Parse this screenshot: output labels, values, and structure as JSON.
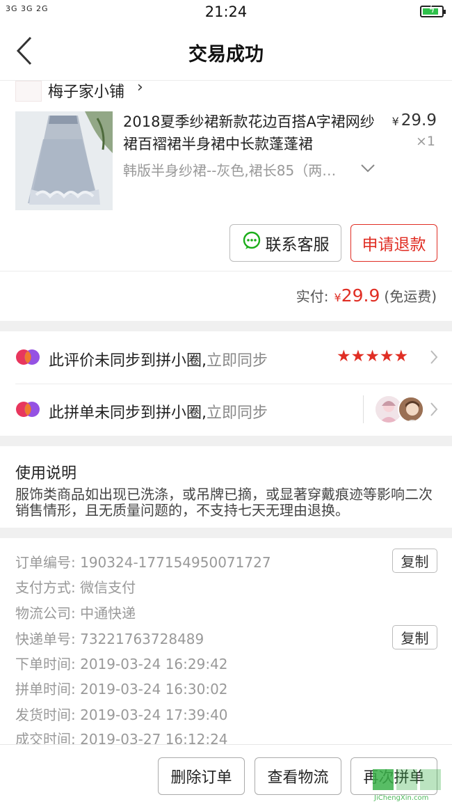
{
  "status_bar": {
    "signal": "3G 3G   2G",
    "time": "21:24",
    "battery_level": 0.8,
    "battery_icon": "battery-charging-icon"
  },
  "nav": {
    "title": "交易成功",
    "back_icon": "back-arrow-icon"
  },
  "shop": {
    "logo_text": "梅子家小铺",
    "name": "梅子家小铺",
    "arrow": "›"
  },
  "product": {
    "title": "2018夏季纱裙新款花边百搭A字裙网纱裙百褶裙半身裙中长款蓬蓬裙",
    "currency": "¥",
    "price": "29.9",
    "quantity": "×1",
    "spec": "韩版半身纱裙--灰色,裙长85（两…"
  },
  "actions": {
    "contact_service": "联系客服",
    "request_refund": "申请退款"
  },
  "payment": {
    "label": "实付:",
    "currency": "¥",
    "amount": "29.9",
    "shipping": "(免运费)"
  },
  "sync": [
    {
      "text": "此评价未同步到拼小圈,",
      "action": "立即同步",
      "rating": 5,
      "stars": "★★★★★"
    },
    {
      "text": "此拼单未同步到拼小圈,",
      "action": "立即同步"
    }
  ],
  "notice": {
    "title": "使用说明",
    "body": "服饰类商品如出现已洗涤，或吊牌已摘，或显著穿戴痕迹等影响二次销售情形，且无质量问题的，不支持七天无理由退换。"
  },
  "order_info": {
    "copy_label": "复制",
    "rows": [
      {
        "label": "订单编号:",
        "value": "190324-177154950071727"
      },
      {
        "label": "支付方式:",
        "value": "微信支付"
      },
      {
        "label": "物流公司:",
        "value": "中通快递"
      },
      {
        "label": "快递单号:",
        "value": "73221763728489"
      },
      {
        "label": "下单时间:",
        "value": "2019-03-24 16:29:42"
      },
      {
        "label": "拼单时间:",
        "value": "2019-03-24 16:30:02"
      },
      {
        "label": "发货时间:",
        "value": "2019-03-24 17:39:40"
      },
      {
        "label": "成交时间:",
        "value": "2019-03-27 16:12:24"
      }
    ]
  },
  "bottom": {
    "delete_order": "删除订单",
    "view_logistics": "查看物流",
    "group_again": "再次拼单"
  },
  "watermark": {
    "text": "JiChengXin.com"
  },
  "colors": {
    "accent": "#e02e24",
    "wechat_green": "#1aad19",
    "gap": "#f0f0f0"
  }
}
